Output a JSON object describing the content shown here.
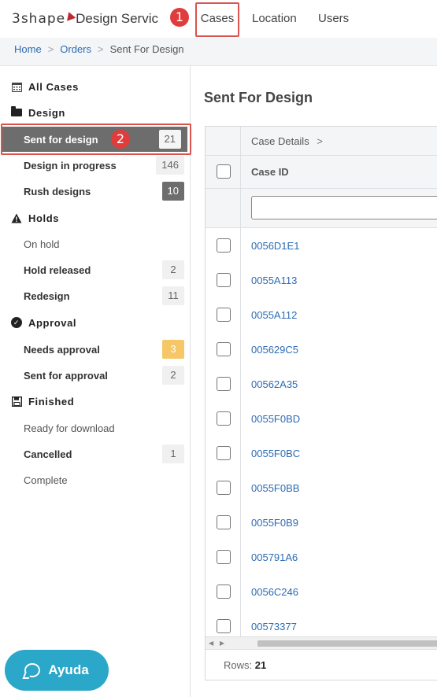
{
  "app": {
    "logo_brand": "3shape",
    "logo_product": "Design Servic"
  },
  "nav": {
    "cases": "Cases",
    "location": "Location",
    "users": "Users"
  },
  "breadcrumb": {
    "home": "Home",
    "orders": "Orders",
    "current": "Sent For Design",
    "separator": ">"
  },
  "annotations": {
    "marker1": "1",
    "marker2": "2"
  },
  "sidebar": {
    "all_cases": "All Cases",
    "design": {
      "heading": "Design",
      "items": [
        {
          "label": "Sent for design",
          "count": "21"
        },
        {
          "label": "Design in progress",
          "count": "146"
        },
        {
          "label": "Rush designs",
          "count": "10"
        }
      ]
    },
    "holds": {
      "heading": "Holds",
      "items": [
        {
          "label": "On hold",
          "count": ""
        },
        {
          "label": "Hold released",
          "count": "2"
        },
        {
          "label": "Redesign",
          "count": "11"
        }
      ]
    },
    "approval": {
      "heading": "Approval",
      "items": [
        {
          "label": "Needs approval",
          "count": "3"
        },
        {
          "label": "Sent for approval",
          "count": "2"
        }
      ]
    },
    "finished": {
      "heading": "Finished",
      "items": [
        {
          "label": "Ready for download",
          "count": ""
        },
        {
          "label": "Cancelled",
          "count": "1"
        },
        {
          "label": "Complete",
          "count": ""
        }
      ]
    }
  },
  "help": {
    "label": "Ayuda"
  },
  "main": {
    "title": "Sent For Design",
    "grid": {
      "group_header": "Case Details",
      "group_chevron": ">",
      "column_case_id": "Case ID",
      "filter_placeholder": "",
      "rows": [
        "0056D1E1",
        "0055A113",
        "0055A112",
        "005629C5",
        "00562A35",
        "0055F0BD",
        "0055F0BC",
        "0055F0BB",
        "0055F0B9",
        "005791A6",
        "0056C246",
        "00573377"
      ],
      "footer_label": "Rows:",
      "footer_count": "21"
    }
  },
  "colors": {
    "accent": "#2d6bb3",
    "active_bg": "#6d6d6d",
    "highlight": "#d9534f",
    "help_bg": "#2aa7c9",
    "warn_badge": "#f6c767"
  }
}
